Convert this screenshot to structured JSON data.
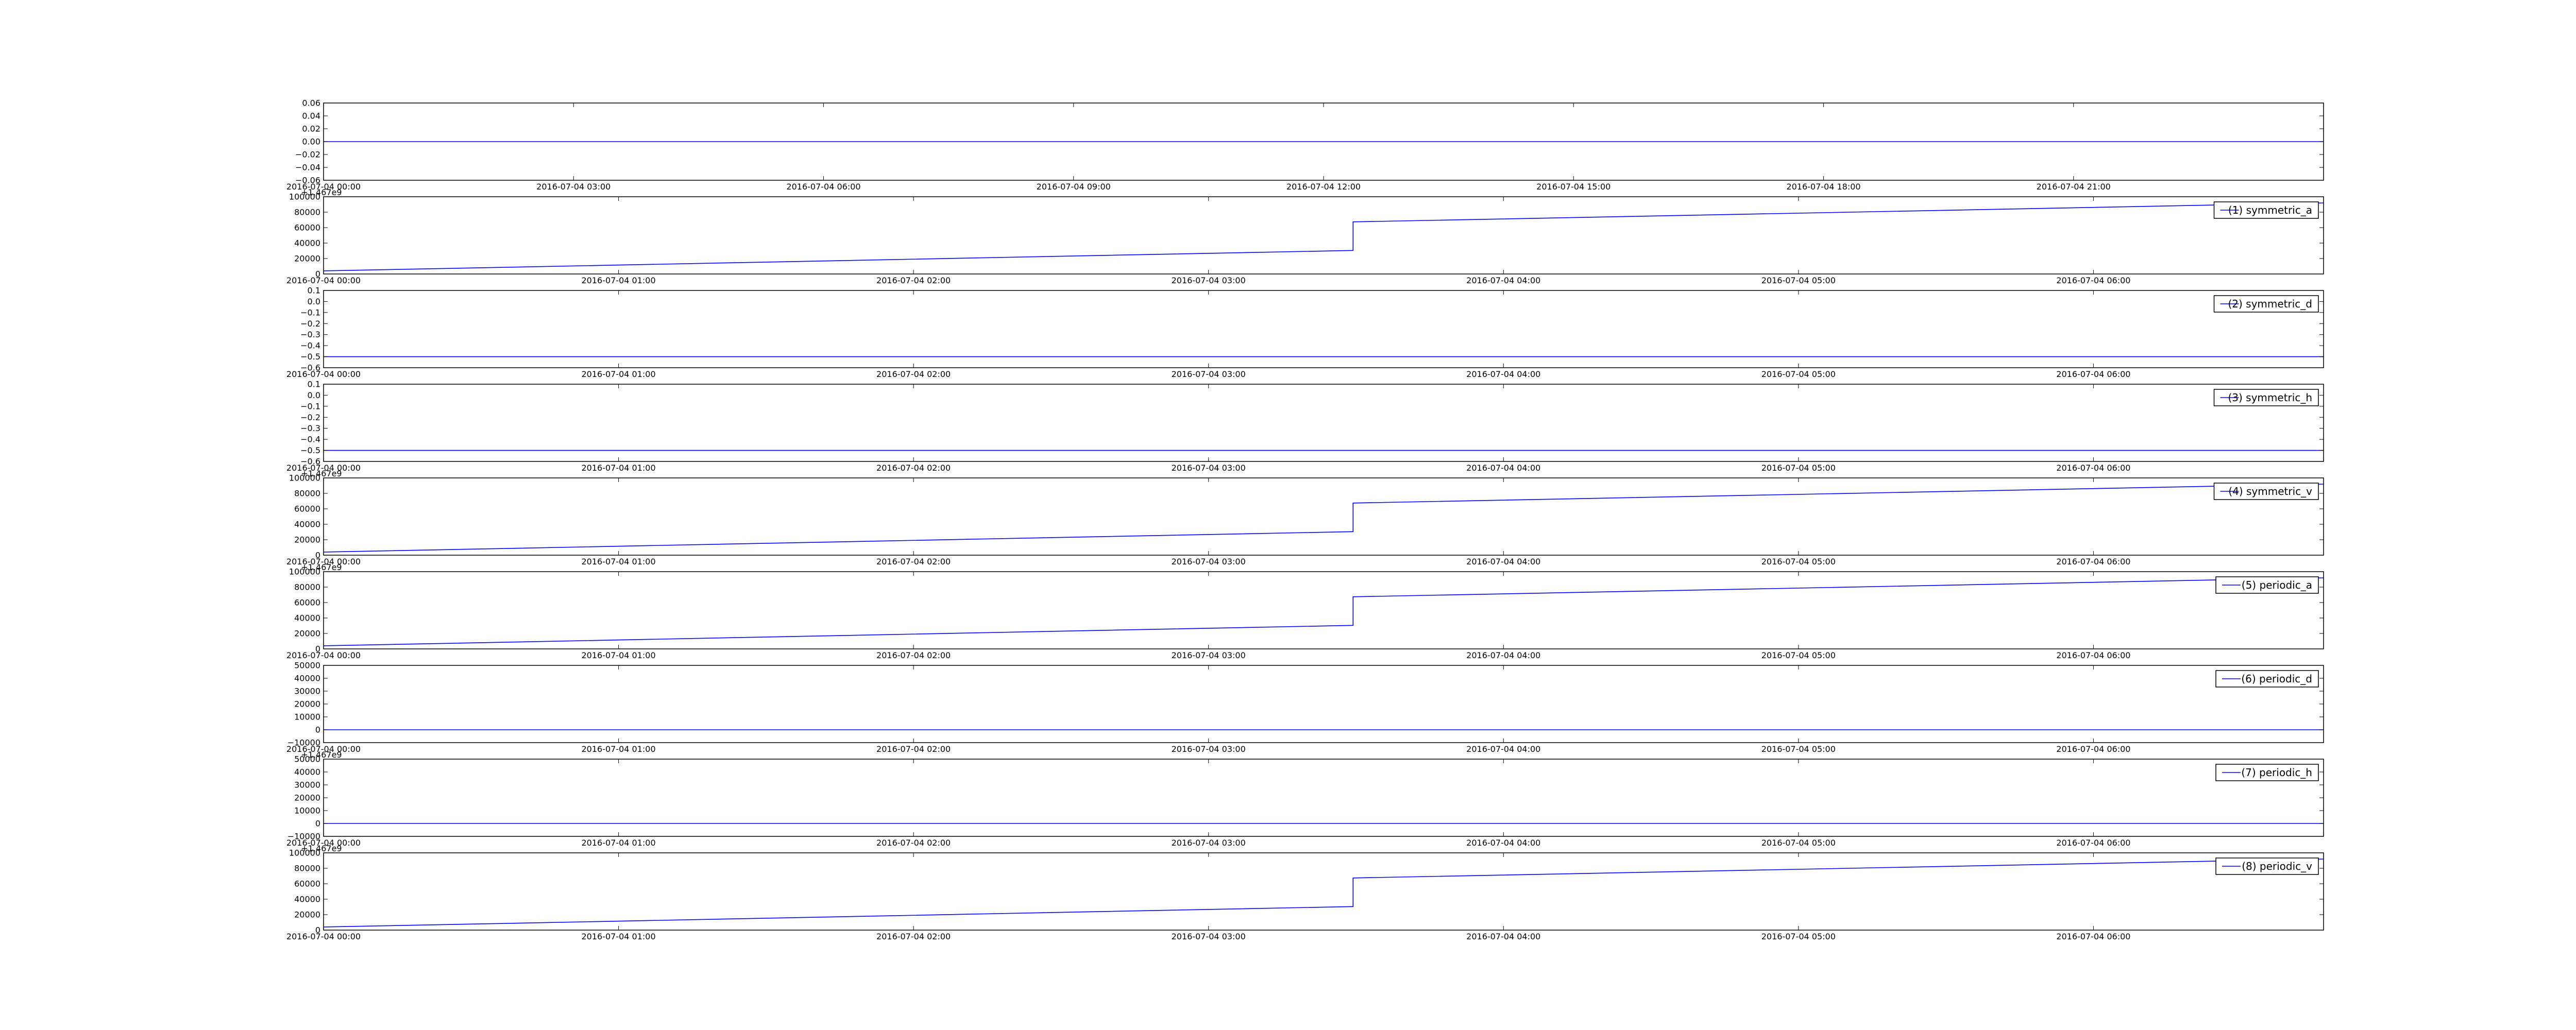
{
  "figure": {
    "background": "#ffffff",
    "line_color": "#0000ff",
    "frame_color": "#000000"
  },
  "chart_data": [
    {
      "type": "line",
      "legend": null,
      "x_kind": "datetime-hours-2016-07-04",
      "xlim": [
        0,
        24
      ],
      "xticks": [
        0,
        3,
        6,
        9,
        12,
        15,
        18,
        21
      ],
      "xticklabels": [
        "2016-07-04 00:00",
        "2016-07-04 03:00",
        "2016-07-04 06:00",
        "2016-07-04 09:00",
        "2016-07-04 12:00",
        "2016-07-04 15:00",
        "2016-07-04 18:00",
        "2016-07-04 21:00"
      ],
      "ylim": [
        -0.06,
        0.06
      ],
      "yticks": [
        0.06,
        0.04,
        0.02,
        0.0,
        -0.02,
        -0.04,
        -0.06
      ],
      "yticklabels": [
        "0.06",
        "0.04",
        "0.02",
        "0.00",
        "−0.02",
        "−0.04",
        "−0.06"
      ],
      "offset_text": "",
      "series": [
        {
          "x": [
            0,
            24
          ],
          "y": [
            0,
            0
          ]
        }
      ]
    },
    {
      "type": "line",
      "legend": "(1) symmetric_a",
      "x_kind": "datetime-hours-2016-07-04",
      "xlim": [
        0,
        6.78
      ],
      "xticks": [
        0,
        1,
        2,
        3,
        4,
        5,
        6
      ],
      "xticklabels": [
        "2016-07-04 00:00",
        "2016-07-04 01:00",
        "2016-07-04 02:00",
        "2016-07-04 03:00",
        "2016-07-04 04:00",
        "2016-07-04 05:00",
        "2016-07-04 06:00"
      ],
      "ylim": [
        0,
        100000
      ],
      "yticks": [
        100000,
        80000,
        60000,
        40000,
        20000,
        0
      ],
      "yticklabels": [
        "100000",
        "80000",
        "60000",
        "40000",
        "20000",
        "0"
      ],
      "offset_text": "+1.467e9",
      "series": [
        {
          "name": "(1) symmetric_a",
          "x": [
            0,
            3.49,
            3.49,
            6.78
          ],
          "y": [
            4000,
            30500,
            67500,
            92000
          ]
        }
      ]
    },
    {
      "type": "line",
      "legend": "(2) symmetric_d",
      "x_kind": "datetime-hours-2016-07-04",
      "xlim": [
        0,
        6.78
      ],
      "xticks": [
        0,
        1,
        2,
        3,
        4,
        5,
        6
      ],
      "xticklabels": [
        "2016-07-04 00:00",
        "2016-07-04 01:00",
        "2016-07-04 02:00",
        "2016-07-04 03:00",
        "2016-07-04 04:00",
        "2016-07-04 05:00",
        "2016-07-04 06:00"
      ],
      "ylim": [
        -0.6,
        0.1
      ],
      "yticks": [
        0.1,
        0.0,
        -0.1,
        -0.2,
        -0.3,
        -0.4,
        -0.5,
        -0.6
      ],
      "yticklabels": [
        "0.1",
        "0.0",
        "−0.1",
        "−0.2",
        "−0.3",
        "−0.4",
        "−0.5",
        "−0.6"
      ],
      "offset_text": "",
      "series": [
        {
          "name": "(2) symmetric_d",
          "x": [
            0,
            6.78
          ],
          "y": [
            -0.5,
            -0.5
          ]
        }
      ]
    },
    {
      "type": "line",
      "legend": "(3) symmetric_h",
      "x_kind": "datetime-hours-2016-07-04",
      "xlim": [
        0,
        6.78
      ],
      "xticks": [
        0,
        1,
        2,
        3,
        4,
        5,
        6
      ],
      "xticklabels": [
        "2016-07-04 00:00",
        "2016-07-04 01:00",
        "2016-07-04 02:00",
        "2016-07-04 03:00",
        "2016-07-04 04:00",
        "2016-07-04 05:00",
        "2016-07-04 06:00"
      ],
      "ylim": [
        -0.6,
        0.1
      ],
      "yticks": [
        0.1,
        0.0,
        -0.1,
        -0.2,
        -0.3,
        -0.4,
        -0.5,
        -0.6
      ],
      "yticklabels": [
        "0.1",
        "0.0",
        "−0.1",
        "−0.2",
        "−0.3",
        "−0.4",
        "−0.5",
        "−0.6"
      ],
      "offset_text": "",
      "series": [
        {
          "name": "(3) symmetric_h",
          "x": [
            0,
            6.78
          ],
          "y": [
            -0.5,
            -0.5
          ]
        }
      ]
    },
    {
      "type": "line",
      "legend": "(4) symmetric_v",
      "x_kind": "datetime-hours-2016-07-04",
      "xlim": [
        0,
        6.78
      ],
      "xticks": [
        0,
        1,
        2,
        3,
        4,
        5,
        6
      ],
      "xticklabels": [
        "2016-07-04 00:00",
        "2016-07-04 01:00",
        "2016-07-04 02:00",
        "2016-07-04 03:00",
        "2016-07-04 04:00",
        "2016-07-04 05:00",
        "2016-07-04 06:00"
      ],
      "ylim": [
        0,
        100000
      ],
      "yticks": [
        100000,
        80000,
        60000,
        40000,
        20000,
        0
      ],
      "yticklabels": [
        "100000",
        "80000",
        "60000",
        "40000",
        "20000",
        "0"
      ],
      "offset_text": "+1.467e9",
      "series": [
        {
          "name": "(4) symmetric_v",
          "x": [
            0,
            3.49,
            3.49,
            6.78
          ],
          "y": [
            4000,
            30500,
            67500,
            92000
          ]
        }
      ]
    },
    {
      "type": "line",
      "legend": "(5) periodic_a",
      "x_kind": "datetime-hours-2016-07-04",
      "xlim": [
        0,
        6.78
      ],
      "xticks": [
        0,
        1,
        2,
        3,
        4,
        5,
        6
      ],
      "xticklabels": [
        "2016-07-04 00:00",
        "2016-07-04 01:00",
        "2016-07-04 02:00",
        "2016-07-04 03:00",
        "2016-07-04 04:00",
        "2016-07-04 05:00",
        "2016-07-04 06:00"
      ],
      "ylim": [
        0,
        100000
      ],
      "yticks": [
        100000,
        80000,
        60000,
        40000,
        20000,
        0
      ],
      "yticklabels": [
        "100000",
        "80000",
        "60000",
        "40000",
        "20000",
        "0"
      ],
      "offset_text": "+1.467e9",
      "series": [
        {
          "name": "(5) periodic_a",
          "x": [
            0,
            3.49,
            3.49,
            6.78
          ],
          "y": [
            4000,
            30500,
            67500,
            92000
          ]
        }
      ]
    },
    {
      "type": "line",
      "legend": "(6) periodic_d",
      "x_kind": "datetime-hours-2016-07-04",
      "xlim": [
        0,
        6.78
      ],
      "xticks": [
        0,
        1,
        2,
        3,
        4,
        5,
        6
      ],
      "xticklabels": [
        "2016-07-04 00:00",
        "2016-07-04 01:00",
        "2016-07-04 02:00",
        "2016-07-04 03:00",
        "2016-07-04 04:00",
        "2016-07-04 05:00",
        "2016-07-04 06:00"
      ],
      "ylim": [
        -10000,
        50000
      ],
      "yticks": [
        50000,
        40000,
        30000,
        20000,
        10000,
        0,
        -10000
      ],
      "yticklabels": [
        "50000",
        "40000",
        "30000",
        "20000",
        "10000",
        "0",
        "−10000"
      ],
      "offset_text": "",
      "series": [
        {
          "name": "(6) periodic_d",
          "x": [
            0,
            6.78
          ],
          "y": [
            0,
            0
          ]
        }
      ]
    },
    {
      "type": "line",
      "legend": "(7) periodic_h",
      "x_kind": "datetime-hours-2016-07-04",
      "xlim": [
        0,
        6.78
      ],
      "xticks": [
        0,
        1,
        2,
        3,
        4,
        5,
        6
      ],
      "xticklabels": [
        "2016-07-04 00:00",
        "2016-07-04 01:00",
        "2016-07-04 02:00",
        "2016-07-04 03:00",
        "2016-07-04 04:00",
        "2016-07-04 05:00",
        "2016-07-04 06:00"
      ],
      "ylim": [
        -10000,
        50000
      ],
      "yticks": [
        50000,
        40000,
        30000,
        20000,
        10000,
        0,
        -10000
      ],
      "yticklabels": [
        "50000",
        "40000",
        "30000",
        "20000",
        "10000",
        "0",
        "−10000"
      ],
      "offset_text": "+1.467e9",
      "series": [
        {
          "name": "(7) periodic_h",
          "x": [
            0,
            6.78
          ],
          "y": [
            0,
            0
          ]
        }
      ]
    },
    {
      "type": "line",
      "legend": "(8) periodic_v",
      "x_kind": "datetime-hours-2016-07-04",
      "xlim": [
        0,
        6.78
      ],
      "xticks": [
        0,
        1,
        2,
        3,
        4,
        5,
        6
      ],
      "xticklabels": [
        "2016-07-04 00:00",
        "2016-07-04 01:00",
        "2016-07-04 02:00",
        "2016-07-04 03:00",
        "2016-07-04 04:00",
        "2016-07-04 05:00",
        "2016-07-04 06:00"
      ],
      "ylim": [
        0,
        100000
      ],
      "yticks": [
        100000,
        80000,
        60000,
        40000,
        20000,
        0
      ],
      "yticklabels": [
        "100000",
        "80000",
        "60000",
        "40000",
        "20000",
        "0"
      ],
      "offset_text": "+1.467e9",
      "series": [
        {
          "name": "(8) periodic_v",
          "x": [
            0,
            3.49,
            3.49,
            6.78
          ],
          "y": [
            4000,
            30500,
            67500,
            92000
          ]
        }
      ]
    }
  ]
}
